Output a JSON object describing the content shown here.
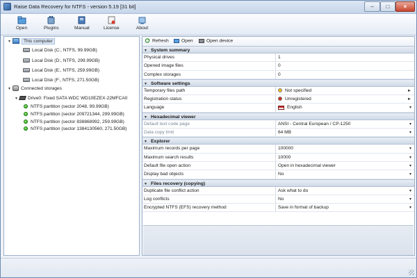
{
  "window": {
    "title": "Raise Data Recovery for NTFS - version 5.19 [31 bit]"
  },
  "toolbar": [
    {
      "label": "Open",
      "icon": "open-icon"
    },
    {
      "label": "Plugins",
      "icon": "plugins-icon"
    },
    {
      "label": "Manual",
      "icon": "manual-icon"
    },
    {
      "label": "License",
      "icon": "license-icon"
    },
    {
      "label": "About",
      "icon": "about-icon"
    }
  ],
  "tree": {
    "this_computer": "This computer",
    "local_disks": [
      "Local Disk (C:, NTFS, 99.99GB)",
      "Local Disk (D:, NTFS, 299.99GB)",
      "Local Disk (E:, NTFS, 259.99GB)",
      "Local Disk (F:, NTFS, 271.50GB)"
    ],
    "connected_storages": "Connected storages",
    "drive": "Drive0: Fixed SATA WDC WD10EZEX-22MFCA0",
    "partitions": [
      "NTFS partition (sector 2048, 99.99GB)",
      "NTFS partition (sector 209721344, 299.99GB)",
      "NTFS partition (sector 838868992, 259.99GB)",
      "NTFS partition (sector 1384130560, 271.50GB)"
    ]
  },
  "right_toolbar": {
    "refresh": "Refresh",
    "open": "Open",
    "open_device": "Open device"
  },
  "sections": {
    "system_summary": {
      "title": "System summary",
      "rows": [
        {
          "key": "Physical drives",
          "value": "1"
        },
        {
          "key": "Opened image files",
          "value": "0"
        },
        {
          "key": "Complex storages",
          "value": "0"
        }
      ]
    },
    "software_settings": {
      "title": "Software settings",
      "rows": [
        {
          "key": "Temporary files path",
          "value": "Not specified",
          "marker": "#f2c21a"
        },
        {
          "key": "Registration status",
          "value": "Unregistered",
          "marker": "#d62a1a"
        },
        {
          "key": "Language",
          "value": "English"
        }
      ]
    },
    "hex_viewer": {
      "title": "Hexadecimal viewer",
      "rows": [
        {
          "key": "Default text code page",
          "value": "ANSI - Central European / CP-1250"
        },
        {
          "key": "Data copy limit",
          "value": "64 MB"
        }
      ]
    },
    "explorer": {
      "title": "Explorer",
      "rows": [
        {
          "key": "Maximum records per page",
          "value": "100000"
        },
        {
          "key": "Maximum search results",
          "value": "10000"
        },
        {
          "key": "Default file open action",
          "value": "Open in hexadecimal viewer"
        },
        {
          "key": "Display bad objects",
          "value": "No"
        }
      ]
    },
    "files_recovery": {
      "title": "Files recovery (copying)",
      "rows": [
        {
          "key": "Duplicate file conflict action",
          "value": "Ask what to do"
        },
        {
          "key": "Log conflicts",
          "value": "No"
        },
        {
          "key": "Encrypted NTFS (EFS) recovery method",
          "value": "Save in format of backup"
        }
      ]
    }
  }
}
